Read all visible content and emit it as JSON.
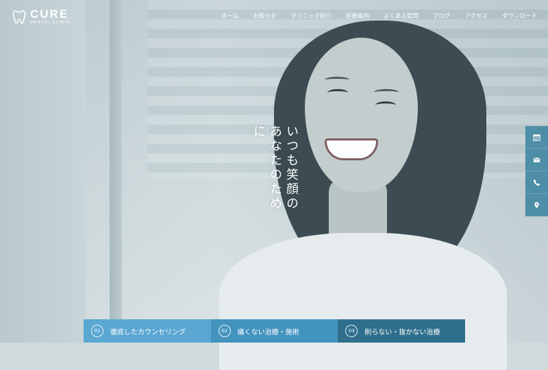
{
  "logo": {
    "name": "CURE",
    "subtitle": "DENTAL CLINIC",
    "icon": "tooth-icon"
  },
  "nav": {
    "items": [
      {
        "label": "ホーム"
      },
      {
        "label": "お知らせ"
      },
      {
        "label": "クリニック紹介"
      },
      {
        "label": "診療案内"
      },
      {
        "label": "よくある質問"
      },
      {
        "label": "ブログ"
      },
      {
        "label": "アクセス"
      },
      {
        "label": "ダウンロード"
      }
    ]
  },
  "hero": {
    "catch_line1": "いつも笑顔の",
    "catch_line2": "あなたのために"
  },
  "sidebar": {
    "icons": [
      "calendar-icon",
      "mail-icon",
      "phone-icon",
      "map-pin-icon"
    ],
    "bg_color": "#4e8ea6"
  },
  "features": [
    {
      "number": "01",
      "label": "徹底したカウンセリング",
      "color": "#5aa7d2"
    },
    {
      "number": "02",
      "label": "痛くない治療・施術",
      "color": "#4393bf"
    },
    {
      "number": "03",
      "label": "削らない・抜かない治療",
      "color": "#2f6f8d"
    }
  ]
}
